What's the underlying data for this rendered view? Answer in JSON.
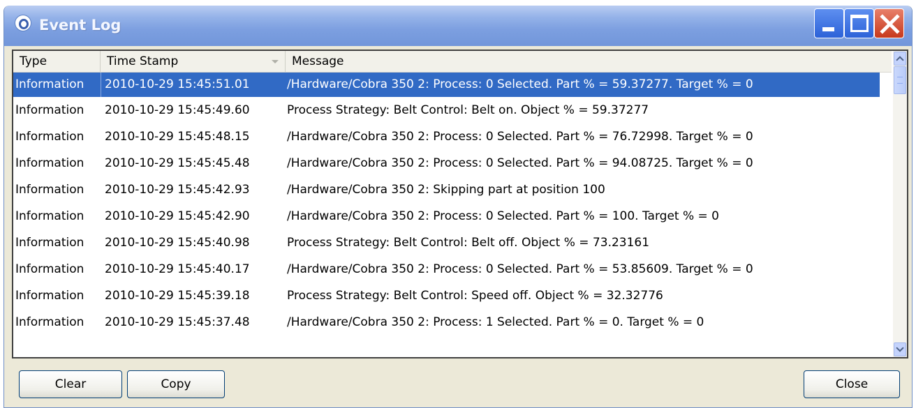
{
  "window": {
    "title": "Event Log",
    "icon": "app-logo-icon"
  },
  "columns": {
    "type": "Type",
    "timestamp": "Time Stamp",
    "message": "Message"
  },
  "rows": [
    {
      "type": "Information",
      "timestamp": "2010-10-29 15:45:51.01",
      "message": "/Hardware/Cobra 350 2: Process:  0 Selected. Part % =  59.37277. Target % =  0",
      "selected": true
    },
    {
      "type": "Information",
      "timestamp": "2010-10-29 15:45:49.60",
      "message": "Process Strategy: Belt Control: Belt on. Object % =  59.37277"
    },
    {
      "type": "Information",
      "timestamp": "2010-10-29 15:45:48.15",
      "message": "/Hardware/Cobra 350 2: Process:  0 Selected. Part % =  76.72998. Target % =  0"
    },
    {
      "type": "Information",
      "timestamp": "2010-10-29 15:45:45.48",
      "message": "/Hardware/Cobra 350 2: Process:  0 Selected. Part % =  94.08725. Target % =  0"
    },
    {
      "type": "Information",
      "timestamp": "2010-10-29 15:45:42.93",
      "message": "/Hardware/Cobra 350 2: Skipping part  at position  100"
    },
    {
      "type": "Information",
      "timestamp": "2010-10-29 15:45:42.90",
      "message": "/Hardware/Cobra 350 2: Process:  0 Selected. Part % =  100. Target % =  0"
    },
    {
      "type": "Information",
      "timestamp": "2010-10-29 15:45:40.98",
      "message": "Process Strategy: Belt Control: Belt off. Object % =  73.23161"
    },
    {
      "type": "Information",
      "timestamp": "2010-10-29 15:45:40.17",
      "message": "/Hardware/Cobra 350 2: Process:  0 Selected. Part % =  53.85609. Target % =  0"
    },
    {
      "type": "Information",
      "timestamp": "2010-10-29 15:45:39.18",
      "message": "Process Strategy: Belt Control: Speed off. Object % =  32.32776"
    },
    {
      "type": "Information",
      "timestamp": "2010-10-29 15:45:37.48",
      "message": "/Hardware/Cobra 350 2: Process:  1 Selected. Part % =  0. Target % =  0"
    }
  ],
  "buttons": {
    "clear": "Clear",
    "copy": "Copy",
    "close": "Close"
  },
  "colors": {
    "selection": "#316ac5",
    "titlebar": "#7c9fe0",
    "close_button": "#c7391c"
  }
}
